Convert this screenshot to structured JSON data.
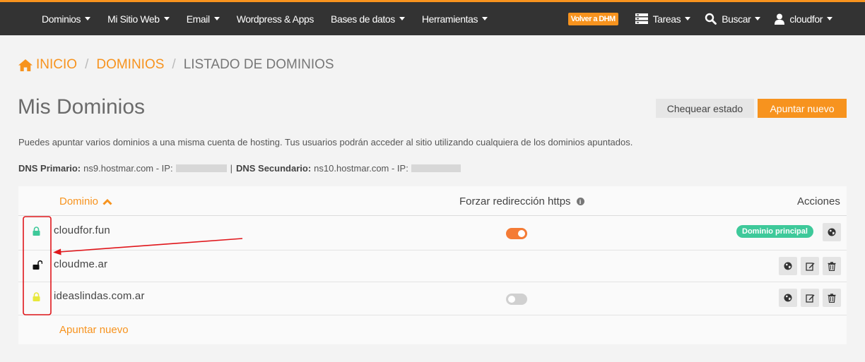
{
  "nav": {
    "items": [
      {
        "label": "Dominios"
      },
      {
        "label": "Mi Sitio Web"
      },
      {
        "label": "Email"
      },
      {
        "label": "Wordpress & Apps"
      },
      {
        "label": "Bases de datos"
      },
      {
        "label": "Herramientas"
      }
    ],
    "volver_label": "Volver a DHM",
    "tareas_label": "Tareas",
    "buscar_label": "Buscar",
    "user_label": "cloudfor"
  },
  "breadcrumb": {
    "home": "INICIO",
    "dominios": "DOMINIOS",
    "current": "LISTADO DE DOMINIOS"
  },
  "page": {
    "title": "Mis Dominios",
    "check_button": "Chequear estado",
    "new_button": "Apuntar nuevo",
    "description": "Puedes apuntar varios dominios a una misma cuenta de hosting. Tus usuarios podrán acceder al sitio utilizando cualquiera de los dominios apuntados.",
    "dns_primary_label": "DNS Primario:",
    "dns_primary_value": "ns9.hostmar.com - IP:",
    "dns_secondary_label": "DNS Secundario:",
    "dns_secondary_value": "ns10.hostmar.com - IP:",
    "dns_separator": "|"
  },
  "table": {
    "col_domain": "Dominio",
    "col_redirect": "Forzar redirección https",
    "col_actions": "Acciones",
    "rows": [
      {
        "domain": "cloudfor.fun",
        "lock": "locked",
        "lock_color": "#3ec99a",
        "redirect": "on",
        "badge": "Dominio principal"
      },
      {
        "domain": "cloudme.ar",
        "lock": "unlocked",
        "lock_color": "#111111",
        "redirect": "none",
        "badge": ""
      },
      {
        "domain": "ideaslindas.com.ar",
        "lock": "locked",
        "lock_color": "#e8e83c",
        "redirect": "off",
        "badge": ""
      }
    ],
    "add_link": "Apuntar nuevo"
  },
  "colors": {
    "accent": "#f7931e",
    "topbar": "#333333",
    "badge": "#3ec99a",
    "annotation": "#e0161b"
  }
}
